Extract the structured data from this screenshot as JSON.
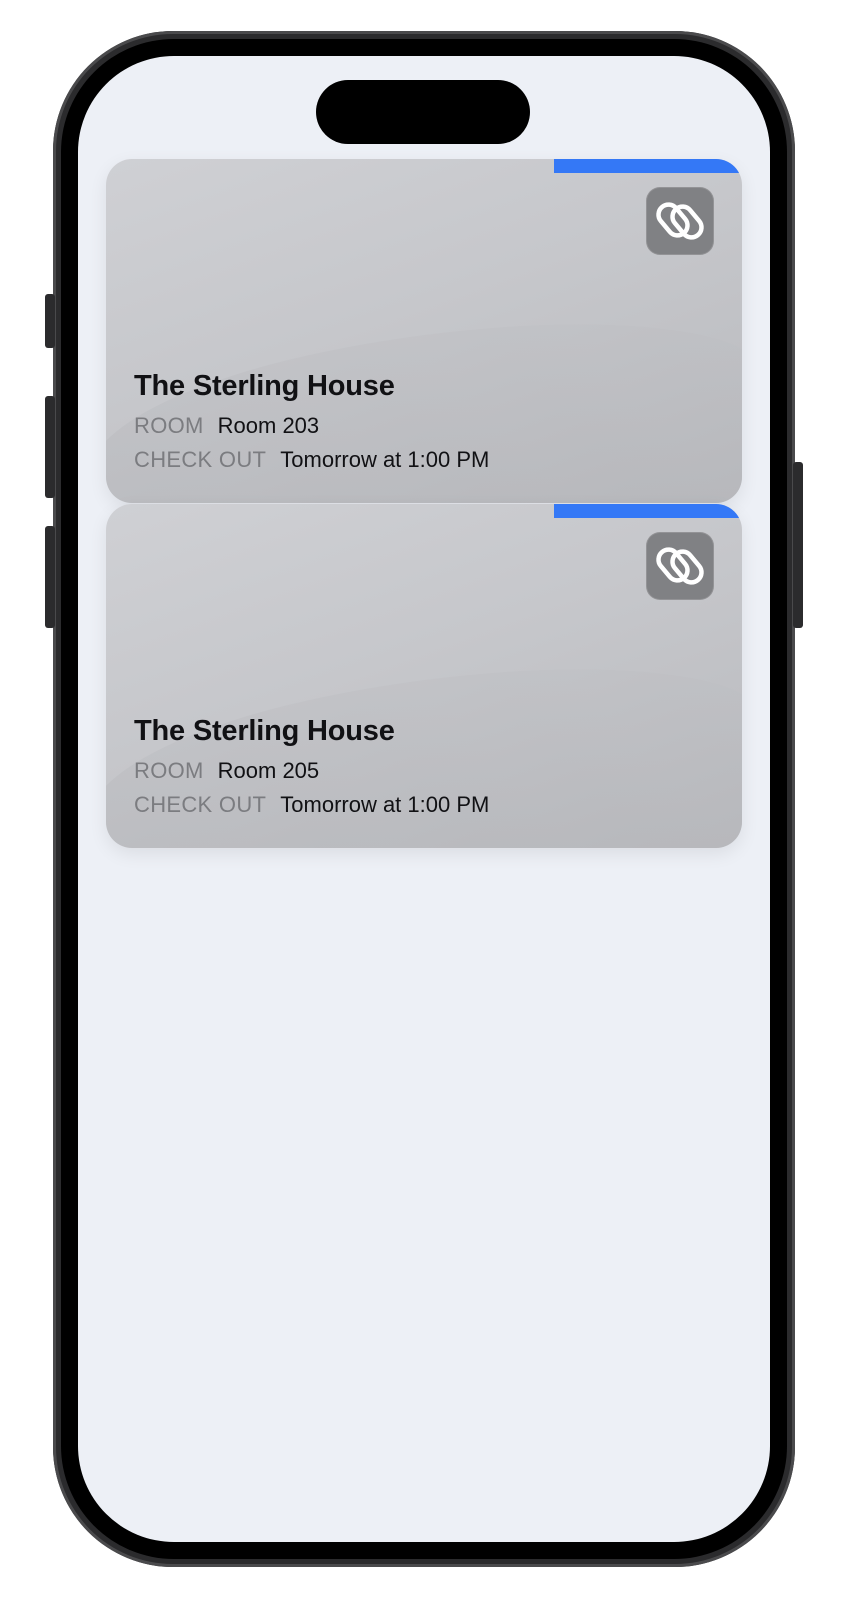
{
  "accent_color": "#3478f6",
  "logo_icon": "sterling-link-logo-icon",
  "cards": [
    {
      "hotel_name": "The Sterling House",
      "room_label": "ROOM",
      "room_value": "Room 203",
      "checkout_label": "CHECK OUT",
      "checkout_value": "Tomorrow at 1:00 PM"
    },
    {
      "hotel_name": "The Sterling House",
      "room_label": "ROOM",
      "room_value": "Room 205",
      "checkout_label": "CHECK OUT",
      "checkout_value": "Tomorrow at 1:00 PM"
    }
  ]
}
